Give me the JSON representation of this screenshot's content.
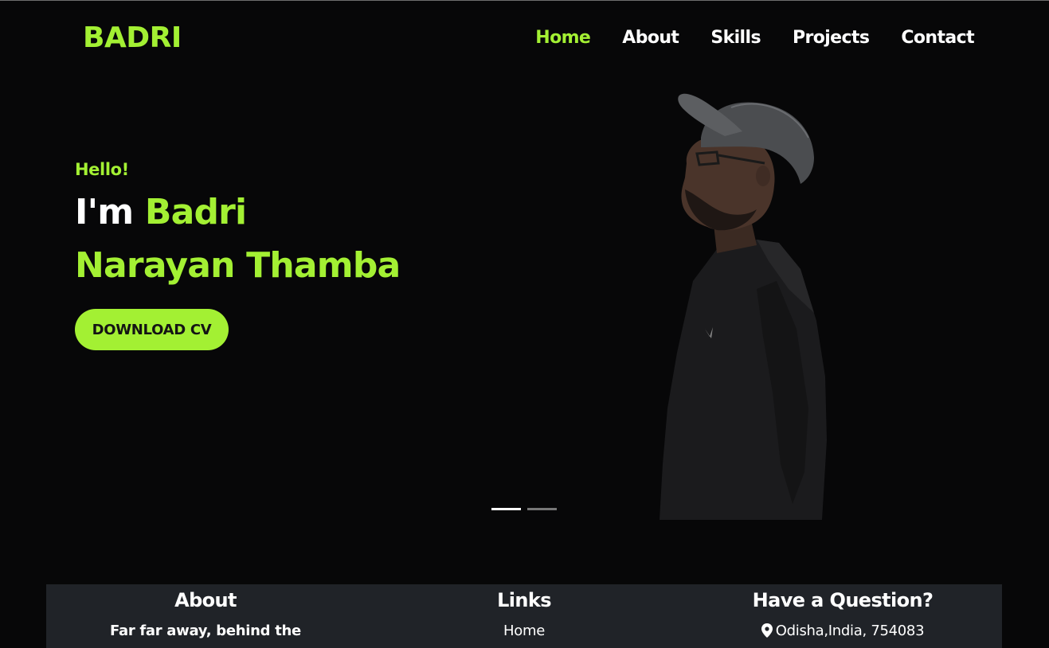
{
  "brand": "BADRI",
  "nav": {
    "items": [
      {
        "label": "Home",
        "active": true
      },
      {
        "label": "About",
        "active": false
      },
      {
        "label": "Skills",
        "active": false
      },
      {
        "label": "Projects",
        "active": false
      },
      {
        "label": "Contact",
        "active": false
      }
    ]
  },
  "hero": {
    "greeting": "Hello!",
    "intro_prefix": "I'm",
    "name_line1": "Badri",
    "name_line2": "Narayan Thamba",
    "cv_button": "DOWNLOAD CV",
    "carousel": {
      "slides": 2,
      "active_index": 0
    }
  },
  "footer": {
    "about": {
      "title": "About",
      "text": "Far far away, behind the"
    },
    "links": {
      "title": "Links",
      "first_link": "Home"
    },
    "contact": {
      "title": "Have a Question?",
      "address": "Odisha,India, 754083",
      "icon": "map-pin-icon"
    }
  },
  "colors": {
    "accent": "#a3f033",
    "background": "#070708",
    "footer": "#202328"
  }
}
